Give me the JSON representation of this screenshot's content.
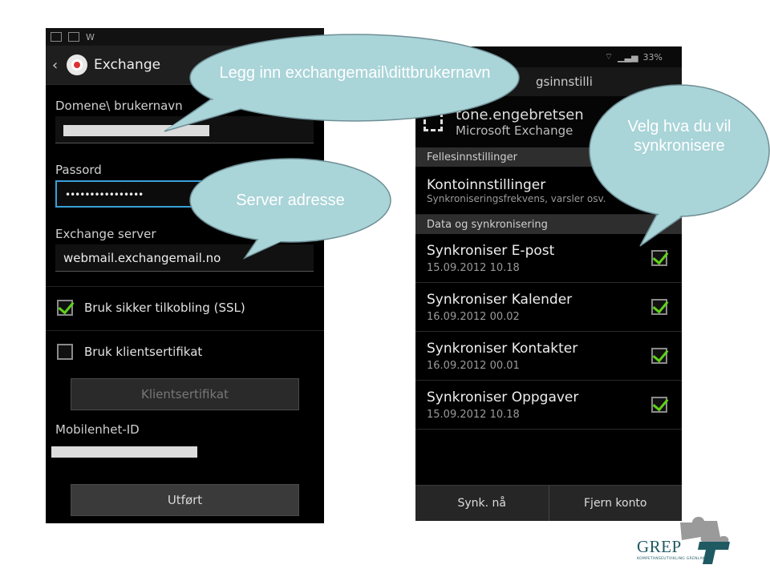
{
  "left_phone": {
    "status_text": "W",
    "action_title": "Exchange",
    "domain_label": "Domene\\ brukernavn",
    "password_label": "Passord",
    "password_value": "••••••••••••••••",
    "server_label": "Exchange server",
    "server_value": "webmail.exchangemail.no",
    "ssl_label": "Bruk sikker tilkobling (SSL)",
    "ssl_checked": true,
    "cert_label": "Bruk klientsertifikat",
    "cert_checked": false,
    "cert_button": "Klientsertifikat",
    "device_id_label": "Mobilenhet-ID",
    "done_button": "Utført"
  },
  "right_phone": {
    "status_text": "33%",
    "title_partial": "gsinnstilli",
    "account_name": "tone.engebretsen",
    "account_type": "Microsoft Exchange",
    "section_common": "Fellesinnstillinger",
    "account_settings_title": "Kontoinnstillinger",
    "account_settings_sub": "Synkroniseringsfrekvens, varsler osv.",
    "section_sync": "Data og synkronisering",
    "sync_items": [
      {
        "title": "Synkroniser E-post",
        "date": "15.09.2012 10.18",
        "checked": true
      },
      {
        "title": "Synkroniser Kalender",
        "date": "16.09.2012 00.02",
        "checked": true
      },
      {
        "title": "Synkroniser Kontakter",
        "date": "16.09.2012 00.01",
        "checked": true
      },
      {
        "title": "Synkroniser Oppgaver",
        "date": "15.09.2012 10.18",
        "checked": true
      }
    ],
    "sync_now_button": "Synk. nå",
    "remove_account_button": "Fjern konto"
  },
  "callouts": {
    "legg_inn": "Legg inn exchangemail\\dittbrukernavn",
    "server": "Server adresse",
    "velg": "Velg hva du vil synkronisere",
    "fill_color": "#a9d4d8",
    "stroke_color": "#6f8f96"
  },
  "logo": {
    "word": "GREP",
    "sub": "KOMPETANSEUTVIKLING GRENLAND",
    "color": "#1f5a63"
  }
}
